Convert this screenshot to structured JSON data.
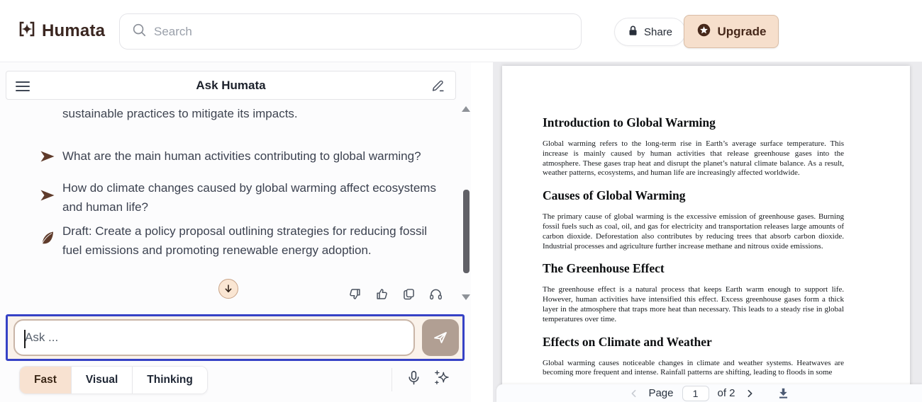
{
  "header": {
    "logo_text": "Humata",
    "search_placeholder": "Search",
    "share_label": "Share",
    "upgrade_label": "Upgrade"
  },
  "chat": {
    "title": "Ask Humata",
    "previous_message_tail": "sustainable practices to mitigate its impacts.",
    "suggestions": [
      {
        "icon": "question-arrow-icon",
        "text": "What are the main human activities contributing to global warming?"
      },
      {
        "icon": "question-arrow-icon",
        "text": "How do climate changes caused by global warming affect ecosystems and human life?"
      },
      {
        "icon": "feather-icon",
        "text": "Draft: Create a policy proposal outlining strategies for reducing fossil fuel emissions and promoting renewable energy adoption."
      }
    ],
    "input_placeholder": "Ask ...",
    "modes": [
      "Fast",
      "Visual",
      "Thinking"
    ],
    "active_mode": "Fast"
  },
  "document": {
    "sections": [
      {
        "heading": "Introduction to Global Warming",
        "body": "Global warming refers to the long-term rise in Earth’s average surface temperature. This increase is mainly caused by human activities that release greenhouse gases into the atmosphere. These gases trap heat and disrupt the planet’s natural climate balance. As a result, weather patterns, ecosystems, and human life are increasingly affected worldwide."
      },
      {
        "heading": "Causes of Global Warming",
        "body": "The primary cause of global warming is the excessive emission of greenhouse gases. Burning fossil fuels such as coal, oil, and gas for electricity and transportation releases large amounts of carbon dioxide. Deforestation also contributes by reducing trees that absorb carbon dioxide. Industrial processes and agriculture further increase methane and nitrous oxide emissions."
      },
      {
        "heading": "The Greenhouse Effect",
        "body": "The greenhouse effect is a natural process that keeps Earth warm enough to support life. However, human activities have intensified this effect. Excess greenhouse gases form a thick layer in the atmosphere that traps more heat than necessary. This leads to a steady rise in global temperatures over time."
      },
      {
        "heading": "Effects on Climate and Weather",
        "body": "Global warming causes noticeable changes in climate and weather systems. Heatwaves are becoming more frequent and intense. Rainfall patterns are shifting, leading to floods in some"
      }
    ]
  },
  "pager": {
    "page_label": "Page",
    "current_page": "1",
    "total_label": "of 2"
  },
  "icons": [
    "humata-logo-icon",
    "search-icon",
    "lock-icon",
    "star-circle-icon",
    "hamburger-icon",
    "edit-icon",
    "question-arrow-icon",
    "feather-icon",
    "scroll-down-circle-icon",
    "thumbs-down-icon",
    "thumbs-up-icon",
    "copy-icon",
    "headphones-icon",
    "mic-icon",
    "sparkles-icon",
    "chevron-left-icon",
    "chevron-right-icon",
    "download-icon"
  ],
  "colors": {
    "brand_brown": "#3a2620",
    "accent_peach": "#f6dfcc",
    "annotation_blue": "#3642c6",
    "send_button": "#b19f93",
    "icon_gray": "#49515e"
  }
}
